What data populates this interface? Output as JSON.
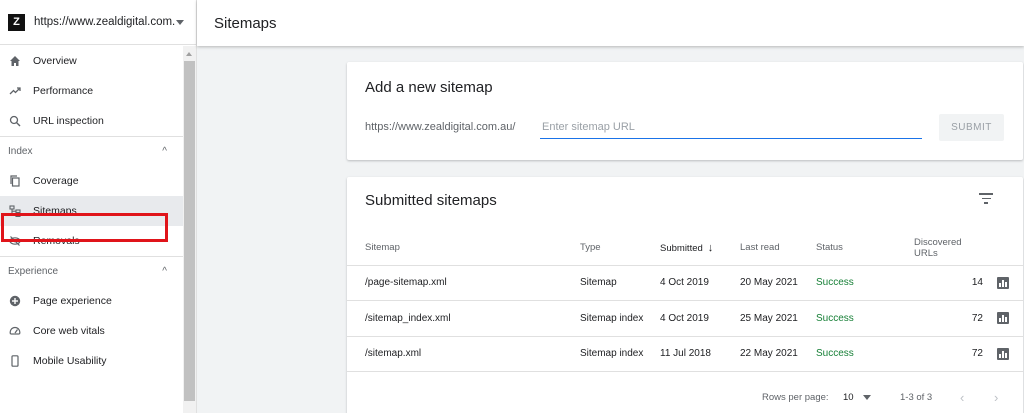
{
  "property": {
    "url": "https://www.zealdigital.com...",
    "logo": "Z"
  },
  "header": {
    "title": "Sitemaps"
  },
  "sidebar": {
    "top_items": [
      {
        "label": "Overview",
        "icon": "home-icon"
      },
      {
        "label": "Performance",
        "icon": "trending-up-icon"
      },
      {
        "label": "URL inspection",
        "icon": "search-icon"
      }
    ],
    "index_section": {
      "label": "Index",
      "items": [
        {
          "label": "Coverage",
          "icon": "copy-icon"
        },
        {
          "label": "Sitemaps",
          "icon": "sitemap-icon",
          "active": true
        },
        {
          "label": "Removals",
          "icon": "eye-off-icon"
        }
      ]
    },
    "experience_section": {
      "label": "Experience",
      "items": [
        {
          "label": "Page experience",
          "icon": "plus-circle-icon"
        },
        {
          "label": "Core web vitals",
          "icon": "gauge-icon"
        },
        {
          "label": "Mobile Usability",
          "icon": "phone-icon"
        }
      ]
    }
  },
  "add_sitemap": {
    "title": "Add a new sitemap",
    "prefix": "https://www.zealdigital.com.au/",
    "placeholder": "Enter sitemap URL",
    "submit_label": "SUBMIT"
  },
  "submitted": {
    "title": "Submitted sitemaps",
    "columns": [
      "Sitemap",
      "Type",
      "Submitted",
      "Last read",
      "Status",
      "Discovered URLs"
    ],
    "rows": [
      {
        "sitemap": "/page-sitemap.xml",
        "type": "Sitemap",
        "submitted": "4 Oct 2019",
        "last_read": "20 May 2021",
        "status": "Success",
        "discovered": "14"
      },
      {
        "sitemap": "/sitemap_index.xml",
        "type": "Sitemap index",
        "submitted": "4 Oct 2019",
        "last_read": "25 May 2021",
        "status": "Success",
        "discovered": "72"
      },
      {
        "sitemap": "/sitemap.xml",
        "type": "Sitemap index",
        "submitted": "11 Jul 2018",
        "last_read": "22 May 2021",
        "status": "Success",
        "discovered": "72"
      }
    ],
    "pager": {
      "rows_per_page_label": "Rows per page:",
      "rows_per_page": "10",
      "range": "1-3 of 3"
    }
  },
  "colors": {
    "accent": "#1a73e8",
    "success": "#188038",
    "highlight": "#e0141a"
  }
}
